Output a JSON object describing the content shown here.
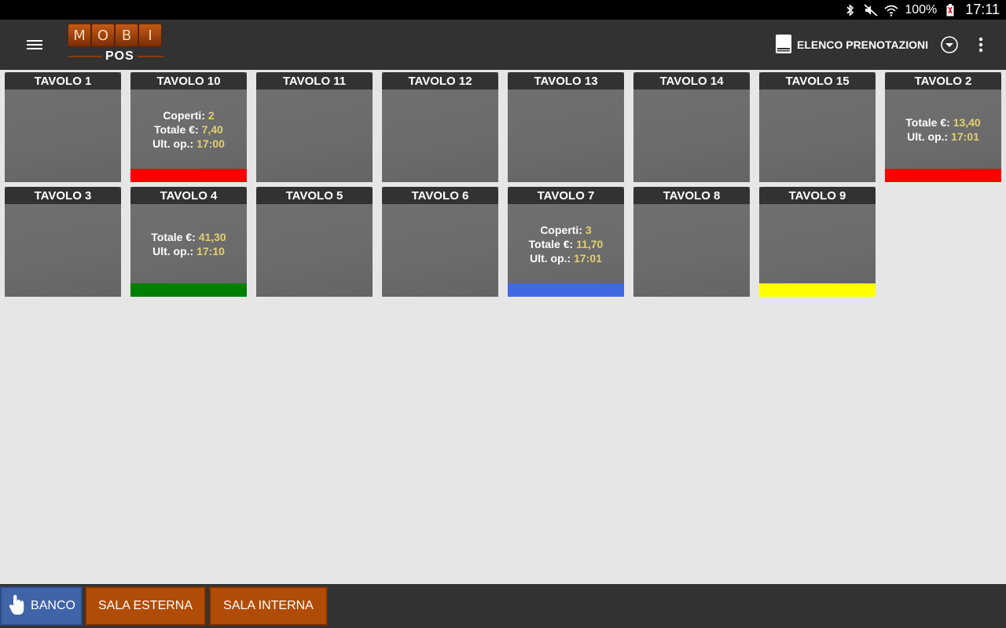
{
  "status_bar": {
    "icons": [
      "bluetooth-icon",
      "mute-icon",
      "wifi-icon",
      "battery-icon"
    ],
    "battery": "100%",
    "time": "17:11"
  },
  "toolbar": {
    "logo_letters": [
      "M",
      "O",
      "B",
      "I"
    ],
    "logo_sub": "POS",
    "booking_label": "ELENCO PRENOTAZIONI",
    "booking_icon": "book-icon",
    "dropdown_icon": "chevron-down-circle-icon",
    "overflow_icon": "more-vert-icon",
    "menu_icon": "hamburger-menu-icon"
  },
  "labels": {
    "coperti": "Coperti:",
    "totale": "Totale €:",
    "ult_op": "Ult. op.:"
  },
  "colors": {
    "red": "#ff0000",
    "green": "#008000",
    "blue": "#4169e1",
    "yellow": "#ffff00",
    "value_text": "#e3cf6e"
  },
  "tables": [
    {
      "name": "TAVOLO 1"
    },
    {
      "name": "TAVOLO 10",
      "coperti": "2",
      "totale": "7,40",
      "ult_op": "17:00",
      "status_color": "#ff0000"
    },
    {
      "name": "TAVOLO 11"
    },
    {
      "name": "TAVOLO 12"
    },
    {
      "name": "TAVOLO 13"
    },
    {
      "name": "TAVOLO 14"
    },
    {
      "name": "TAVOLO 15"
    },
    {
      "name": "TAVOLO 2",
      "totale": "13,40",
      "ult_op": "17:01",
      "status_color": "#ff0000"
    },
    {
      "name": "TAVOLO 3"
    },
    {
      "name": "TAVOLO 4",
      "totale": "41,30",
      "ult_op": "17:10",
      "status_color": "#008000"
    },
    {
      "name": "TAVOLO 5"
    },
    {
      "name": "TAVOLO 6"
    },
    {
      "name": "TAVOLO 7",
      "coperti": "3",
      "totale": "11,70",
      "ult_op": "17:01",
      "status_color": "#4169e1"
    },
    {
      "name": "TAVOLO 8"
    },
    {
      "name": "TAVOLO 9",
      "status_color": "#ffff00"
    }
  ],
  "bottom_bar": {
    "banco_label": "BANCO",
    "banco_icon": "hand-pointer-icon",
    "esterna_label": "SALA ESTERNA",
    "interna_label": "SALA INTERNA"
  }
}
